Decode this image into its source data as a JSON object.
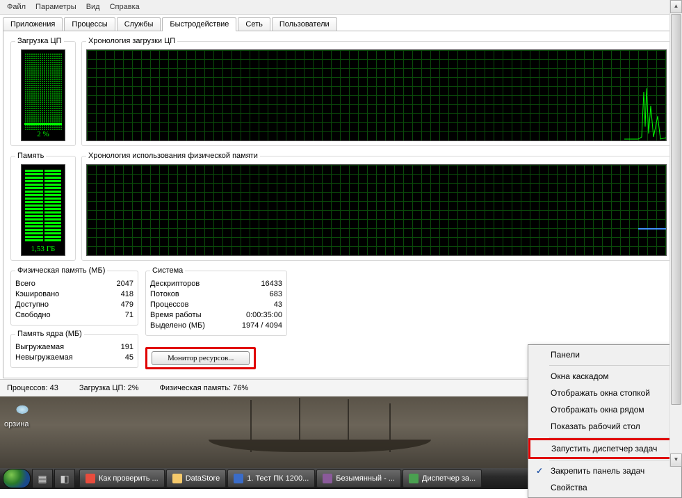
{
  "menu": {
    "file": "Файл",
    "params": "Параметры",
    "view": "Вид",
    "help": "Справка"
  },
  "tabs": {
    "apps": "Приложения",
    "procs": "Процессы",
    "svcs": "Службы",
    "perf": "Быстродействие",
    "net": "Сеть",
    "users": "Пользователи"
  },
  "cpu": {
    "title": "Загрузка ЦП",
    "hist": "Хронология загрузки ЦП",
    "value": "2 %"
  },
  "mem": {
    "title": "Память",
    "hist": "Хронология использования физической памяти",
    "value": "1,53 ГБ"
  },
  "phys": {
    "title": "Физическая память (МБ)",
    "rows": [
      [
        "Всего",
        "2047"
      ],
      [
        "Кэшировано",
        "418"
      ],
      [
        "Доступно",
        "479"
      ],
      [
        "Свободно",
        "71"
      ]
    ]
  },
  "kernel": {
    "title": "Память ядра (МБ)",
    "rows": [
      [
        "Выгружаемая",
        "191"
      ],
      [
        "Невыгружаемая",
        "45"
      ]
    ]
  },
  "sys": {
    "title": "Система",
    "rows": [
      [
        "Дескрипторов",
        "16433"
      ],
      [
        "Потоков",
        "683"
      ],
      [
        "Процессов",
        "43"
      ],
      [
        "Время работы",
        "0:00:35:00"
      ],
      [
        "Выделено (МБ)",
        "1974 / 4094"
      ]
    ]
  },
  "btn": {
    "res": "Монитор ресурсов..."
  },
  "status": {
    "procs": "Процессов: 43",
    "cpu": "Загрузка ЦП: 2%",
    "mem": "Физическая память: 76%"
  },
  "recycle": "орзина",
  "taskbar": [
    {
      "label": "Как проверить ...",
      "color": "#e84c3d"
    },
    {
      "label": "DataStore",
      "color": "#f5c96b"
    },
    {
      "label": "1. Тест ПК 1200...",
      "color": "#3a6cc8"
    },
    {
      "label": "Безымянный - ...",
      "color": "#8a5a9a"
    },
    {
      "label": "Диспетчер за...",
      "color": "#4aa050"
    }
  ],
  "ctx": {
    "panels": "Панели",
    "cascade": "Окна каскадом",
    "stack": "Отображать окна стопкой",
    "side": "Отображать окна рядом",
    "desk": "Показать рабочий стол",
    "taskmgr": "Запустить диспетчер задач",
    "lock": "Закрепить панель задач",
    "props": "Свойства"
  },
  "chart_data": {
    "type": "line",
    "series": [
      {
        "name": "CPU %",
        "current": 2,
        "ylim": [
          0,
          100
        ],
        "recent_spike_peak": 58
      },
      {
        "name": "Memory GB",
        "current": 1.53,
        "ylim": [
          0,
          2.0
        ]
      }
    ]
  }
}
